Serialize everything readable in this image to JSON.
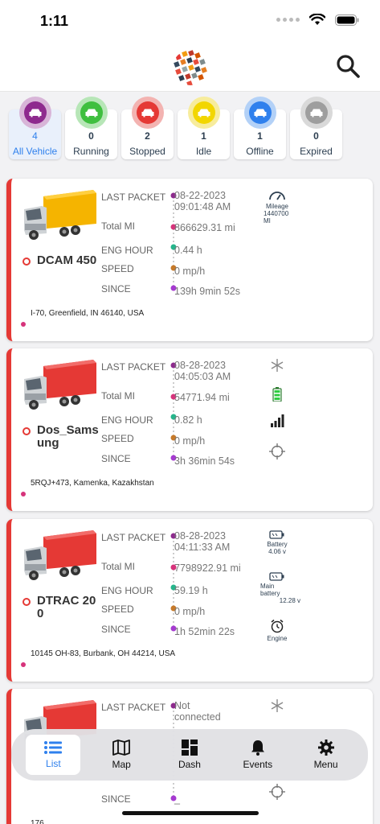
{
  "status_bar": {
    "time": "1:11"
  },
  "filters": [
    {
      "count": "4",
      "label": "All Vehicle",
      "color": "#8e2a8e",
      "ring": "#d8b5d8",
      "active": true
    },
    {
      "count": "0",
      "label": "Running",
      "color": "#3fbf3f",
      "ring": "#b7e6b7",
      "active": false
    },
    {
      "count": "2",
      "label": "Stopped",
      "color": "#e53935",
      "ring": "#f3b3b1",
      "active": false
    },
    {
      "count": "1",
      "label": "Idle",
      "color": "#f2d600",
      "ring": "#f7ec9c",
      "active": false
    },
    {
      "count": "1",
      "label": "Offline",
      "color": "#2f80ed",
      "ring": "#b3d1f7",
      "active": false
    },
    {
      "count": "0",
      "label": "Expired",
      "color": "#9e9e9e",
      "ring": "#d9d9d9",
      "active": false
    }
  ],
  "field_labels": {
    "last_packet": "LAST PACKET",
    "total_mi": "Total MI",
    "eng_hour": "ENG HOUR",
    "speed": "SPEED",
    "since": "SINCE"
  },
  "vehicles": [
    {
      "name": "DCAM 450",
      "truck_color": "#f5b400",
      "last_packet_date": "08-22-2023",
      "last_packet_time": "09:01:48 AM",
      "total_mi": "866629.31 mi",
      "eng_hour": "0.44 h",
      "speed": "0 mp/h",
      "since": "139h 9min 52s",
      "address": "I-70, Greenfield, IN 46140, USA",
      "mileage_label": "Mileage",
      "mileage_value": "1440700 MI"
    },
    {
      "name": "Dos_Samsung",
      "truck_color": "#e53935",
      "last_packet_date": "08-28-2023",
      "last_packet_time": "04:05:03 AM",
      "total_mi": "54771.94 mi",
      "eng_hour": "0.82 h",
      "speed": "0 mp/h",
      "since": "3h 36min 54s",
      "address": "5RQJ+473, Kamenka, Kazakhstan"
    },
    {
      "name": "DTRAC 200",
      "truck_color": "#e53935",
      "last_packet_date": "08-28-2023",
      "last_packet_time": "04:11:33 AM",
      "total_mi": "7798922.91 mi",
      "eng_hour": "59.19 h",
      "speed": "0 mp/h",
      "since": "1h 52min 22s",
      "address": "10145 OH-83, Burbank, OH 44214, USA",
      "battery_label": "Battery",
      "battery_value": "4.06 v",
      "main_battery_label": "Main battery",
      "main_battery_value": "12.28 v",
      "engine_label": "Engine"
    },
    {
      "name": "",
      "truck_color": "#e53935",
      "last_packet_date": "Not",
      "last_packet_time": "connected",
      "since": "_",
      "address": "176"
    }
  ],
  "nav": [
    {
      "label": "List",
      "icon": "list-icon",
      "active": true
    },
    {
      "label": "Map",
      "icon": "map-icon",
      "active": false
    },
    {
      "label": "Dash",
      "icon": "dashboard-icon",
      "active": false
    },
    {
      "label": "Events",
      "icon": "bell-icon",
      "active": false
    },
    {
      "label": "Menu",
      "icon": "gear-icon",
      "active": false
    }
  ]
}
